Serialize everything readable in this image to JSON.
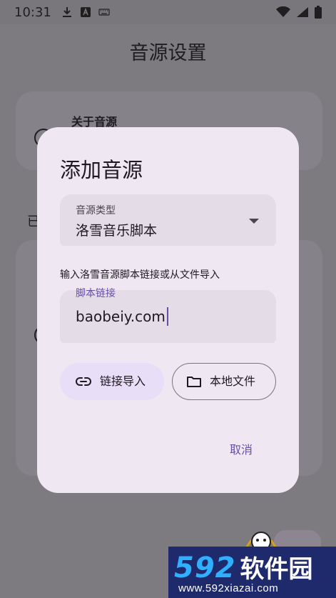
{
  "status_bar": {
    "time": "10:31"
  },
  "page": {
    "title": "音源设置",
    "card_title": "关于音源",
    "side_text": "已"
  },
  "dialog": {
    "title": "添加音源",
    "type_field": {
      "label": "音源类型",
      "value": "洛雪音乐脚本"
    },
    "hint": "输入洛雪音源脚本链接或从文件导入",
    "link_field": {
      "label": "脚本链接",
      "value": "baobeiy.com"
    },
    "link_import_label": "链接导入",
    "local_file_label": "本地文件",
    "cancel_label": "取消"
  },
  "watermark": {
    "number": "592",
    "name": "软件园",
    "url": "www.592xiazai.com"
  },
  "colors": {
    "primary": "#6750a4",
    "highlight_box": "#d9232d",
    "dialog_bg": "#efe7f1"
  }
}
